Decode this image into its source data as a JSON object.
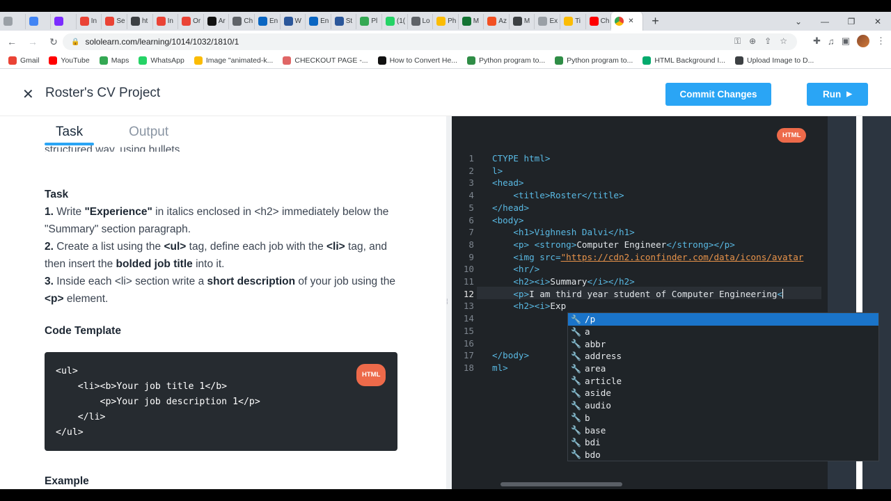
{
  "tabs": [
    {
      "label": "",
      "color": "#9aa0a6"
    },
    {
      "label": "",
      "color": "#4285f4"
    },
    {
      "label": "",
      "color": "#7b2cff"
    },
    {
      "label": "In",
      "color": "#ea4335"
    },
    {
      "label": "Se",
      "color": "#ea4335"
    },
    {
      "label": "ht",
      "color": "#3c4043"
    },
    {
      "label": "In",
      "color": "#ea4335"
    },
    {
      "label": "Or",
      "color": "#ea4335"
    },
    {
      "label": "Ar",
      "color": "#111111"
    },
    {
      "label": "Ch",
      "color": "#5f6368"
    },
    {
      "label": "En",
      "color": "#0a66c2"
    },
    {
      "label": "W",
      "color": "#2b579a"
    },
    {
      "label": "En",
      "color": "#0a66c2"
    },
    {
      "label": "St",
      "color": "#2b579a"
    },
    {
      "label": "Pl",
      "color": "#34a853"
    },
    {
      "label": "(1(",
      "color": "#25d366"
    },
    {
      "label": "Lo",
      "color": "#5f6368"
    },
    {
      "label": "Ph",
      "color": "#fbbc04"
    },
    {
      "label": "M",
      "color": "#137333"
    },
    {
      "label": "Az",
      "color": "#f25022"
    },
    {
      "label": "M",
      "color": "#3c4043"
    },
    {
      "label": "Ex",
      "color": "#9aa0a6"
    },
    {
      "label": "Ti",
      "color": "#fbbc04"
    },
    {
      "label": "Ch",
      "color": "#ff0000"
    }
  ],
  "address": {
    "url": "sololearn.com/learning/1014/1032/1810/1"
  },
  "bookmarks": [
    {
      "label": "Gmail",
      "color": "#ea4335"
    },
    {
      "label": "YouTube",
      "color": "#ff0000"
    },
    {
      "label": "Maps",
      "color": "#34a853"
    },
    {
      "label": "WhatsApp",
      "color": "#25d366"
    },
    {
      "label": "Image \"animated-k...",
      "color": "#fbbc04"
    },
    {
      "label": "CHECKOUT PAGE -...",
      "color": "#e06666"
    },
    {
      "label": "How to Convert He...",
      "color": "#111111"
    },
    {
      "label": "Python program to...",
      "color": "#2f8d46"
    },
    {
      "label": "Python program to...",
      "color": "#2f8d46"
    },
    {
      "label": "HTML Background I...",
      "color": "#04aa6d"
    },
    {
      "label": "Upload Image to D...",
      "color": "#3c4043"
    }
  ],
  "header": {
    "title": "Roster's CV Project",
    "commit_label": "Commit Changes",
    "run_label": "Run"
  },
  "lesson": {
    "tab_task": "Task",
    "tab_output": "Output",
    "cut_line": "structured way, using bullets.",
    "task_heading": "Task",
    "s1_num": "1.",
    "s1_a": " Write ",
    "s1_b": "\"Experience\"",
    "s1_c": " in italics enclosed in <h2> immediately below the \"Summary\" section paragraph.",
    "s2_num": "2.",
    "s2_a": " Create a list using the ",
    "s2_b": "<ul>",
    "s2_c": " tag, define each job with the ",
    "s2_d": "<li>",
    "s2_e": " tag, and then insert the ",
    "s2_f": "bolded job title",
    "s2_g": " into it.",
    "s3_num": "3.",
    "s3_a": " Inside each <li> section write a ",
    "s3_b": "short description",
    "s3_c": " of your job using the ",
    "s3_d": "<p>",
    "s3_e": " element.",
    "template_heading": "Code Template",
    "template_code": "<ul>\n    <li><b>Your job title 1</b>\n        <p>Your job description 1</p>\n    </li>\n</ul>",
    "badge": "HTML",
    "example_heading": "Example"
  },
  "editor": {
    "badge": "HTML",
    "line_numbers": [
      "1",
      "2",
      "3",
      "4",
      "5",
      "6",
      "7",
      "8",
      "9",
      "10",
      "11",
      "12",
      "13",
      "14",
      "15",
      "16",
      "17",
      "18"
    ],
    "current_line": "12",
    "lines": {
      "l1": "CTYPE html>",
      "l2": "l>",
      "l3": "<head>",
      "l4": "<title>Roster</title>",
      "l5": "</head>",
      "l6": "<body>",
      "l7": "<h1>Vighnesh Dalvi</h1>",
      "l8a": "<p> <strong>",
      "l8b": "Computer Engineer",
      "l8c": "</strong></p>",
      "l9a": "<img src=",
      "l9b": "\"https://cdn2.iconfinder.com/data/icons/avatar",
      "l10": "<hr/>",
      "l11a": "<h2><i>",
      "l11b": "Summary",
      "l11c": "</i></h2>",
      "l12a": "<p>",
      "l12b": "I am third year student of Computer Engineering",
      "l12c": "<",
      "l13a": "<h2><i>",
      "l13b": "Exp",
      "l17": "</body>",
      "l18": "ml>"
    }
  },
  "autocomplete": {
    "items": [
      "/p",
      "a",
      "abbr",
      "address",
      "area",
      "article",
      "aside",
      "audio",
      "b",
      "base",
      "bdi",
      "bdo"
    ],
    "selected": "/p",
    "icon": "wrench-icon"
  }
}
